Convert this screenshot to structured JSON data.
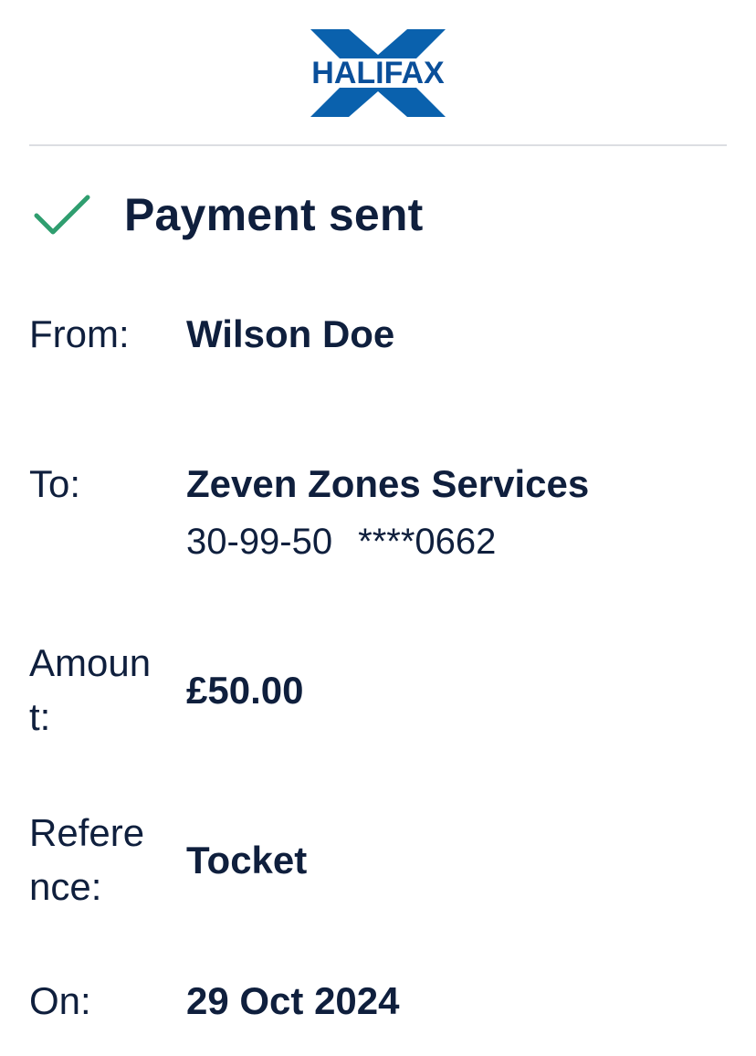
{
  "logo": {
    "brand": "HALIFAX",
    "colors": {
      "x_mark": "#0a61ad",
      "text": "#0a4f9a"
    }
  },
  "status": {
    "icon": "check-icon",
    "title": "Payment sent",
    "icon_color": "#2f9e6f"
  },
  "details": {
    "from_label": "From:",
    "from_value": "Wilson Doe",
    "to_label": "To:",
    "to_value": "Zeven Zones Services",
    "to_sort_code": "30-99-50",
    "to_account": "****0662",
    "amount_label": "Amount:",
    "amount_value": "£50.00",
    "reference_label": "Reference:",
    "reference_value": "Tocket",
    "on_label": "On:",
    "on_value": "29 Oct 2024"
  }
}
